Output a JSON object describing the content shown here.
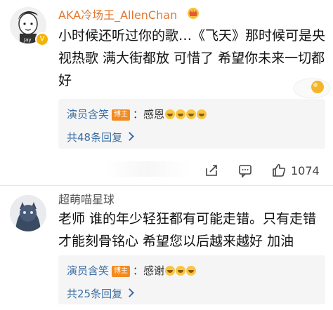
{
  "comments": [
    {
      "username": "AKA冷场王_AllenChan",
      "text": "小时候还听过你的歌…《飞天》那时候可是央视热歌 满大街都放 可惜了 希望你未来一切都好",
      "reply": {
        "name": "演员含笑",
        "badge": "博主",
        "text": "：感恩",
        "count_text": "共48条回复"
      },
      "likes": "1074"
    },
    {
      "username": "超萌喵星球",
      "text": "老师 谁的年少轻狂都有可能走错。只有走错才能刻骨铭心 希望您以后越来越好 加油",
      "reply": {
        "name": "演员含笑",
        "badge": "博主",
        "text": "：感谢",
        "count_text": "共25条回复"
      }
    }
  ],
  "colors": {
    "vip_name": "#e6772e",
    "link": "#3a6ea5",
    "badge": "#f28b20"
  },
  "icons": [
    "crown-icon",
    "egg-emoji-icon",
    "share-icon",
    "comment-icon",
    "like-icon",
    "crying-emoji-icon",
    "chevron-right-icon"
  ]
}
